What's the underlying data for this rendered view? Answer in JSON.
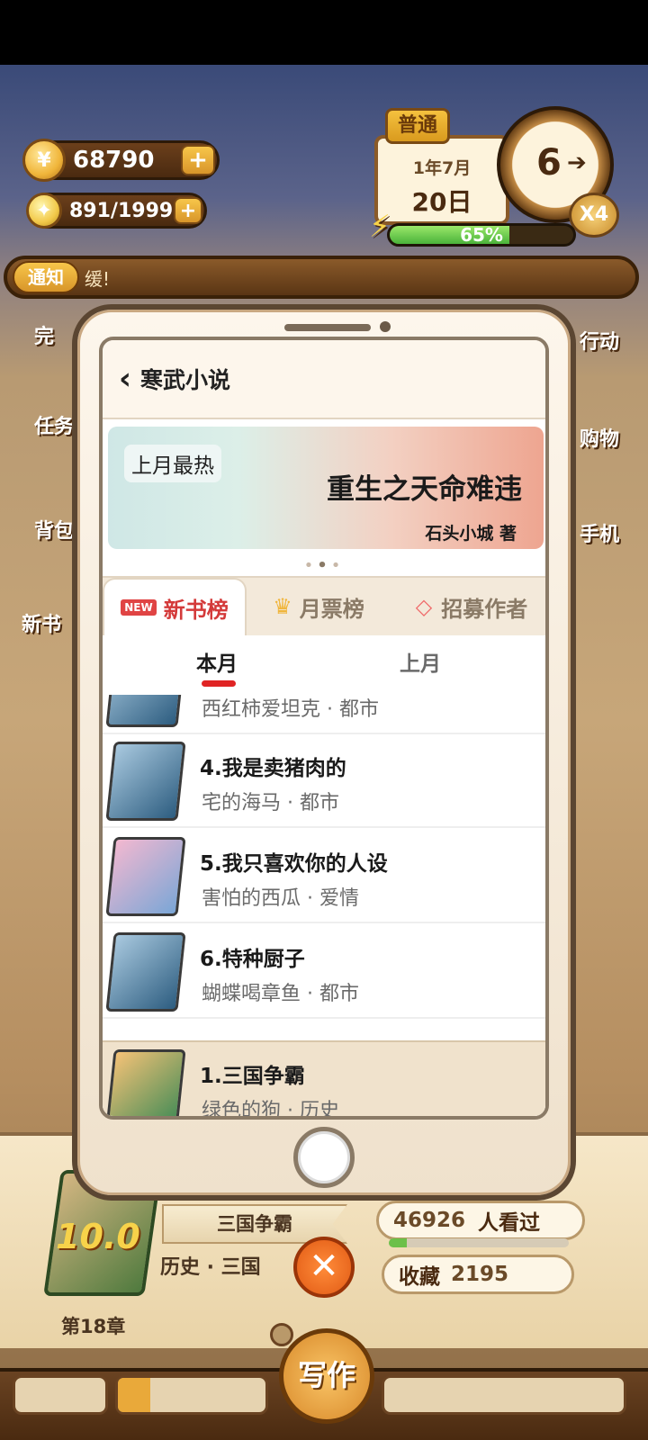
{
  "hud": {
    "coins": "68790",
    "ideas": "891/1999",
    "difficulty_tag": "普通",
    "date_month": "1年7月",
    "date_day": "20日",
    "clock_value": "6",
    "speed": "X4",
    "energy_percent_text": "65%",
    "energy_fraction": 0.65
  },
  "notice": {
    "tag": "通知",
    "text": "缓!"
  },
  "side_menu": {
    "right_items": [
      "行动",
      "购物",
      "手机"
    ],
    "left_items": [
      "完",
      "任务",
      "背包",
      "新书"
    ]
  },
  "phone": {
    "title": "寒武小说",
    "banner": {
      "tag": "上月最热",
      "title": "重生之天命难违",
      "author": "石头小城 著"
    },
    "tabs": [
      {
        "badge": "NEW",
        "label": "新书榜"
      },
      {
        "label": "月票榜"
      },
      {
        "label": "招募作者"
      }
    ],
    "subtabs": [
      "本月",
      "上月"
    ],
    "books": [
      {
        "title": "",
        "subtitle": "西红柿爱坦克 · 都市"
      },
      {
        "title": "4.我是卖猪肉的",
        "subtitle": "宅的海马 · 都市"
      },
      {
        "title": "5.我只喜欢你的人设",
        "subtitle": "害怕的西瓜 · 爱情"
      },
      {
        "title": "6.特种厨子",
        "subtitle": "蝴蝶喝章鱼 · 都市"
      }
    ],
    "pinned_book": {
      "title": "1.三国争霸",
      "subtitle": "绿色的狗 · 历史"
    }
  },
  "current_book": {
    "score": "10.0",
    "chapter": "第18章",
    "name": "三国争霸",
    "genre": "历史 · 三国",
    "views_count": "46926",
    "views_label": "人看过",
    "favorites_label": "收藏",
    "favorites_count": "2195"
  },
  "bottom": {
    "write_label": "写作"
  }
}
